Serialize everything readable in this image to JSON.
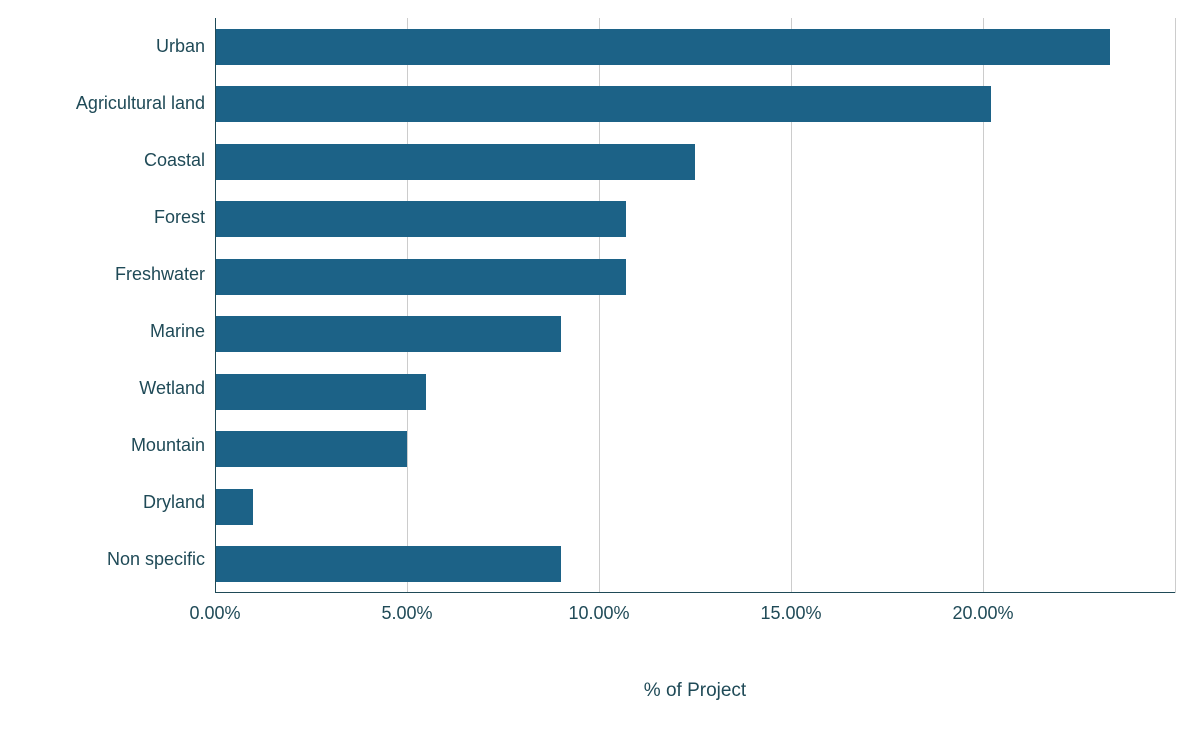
{
  "chart_data": {
    "type": "bar",
    "orientation": "horizontal",
    "categories": [
      "Urban",
      "Agricultural land",
      "Coastal",
      "Forest",
      "Freshwater",
      "Marine",
      "Wetland",
      "Mountain",
      "Dryland",
      "Non specific"
    ],
    "values": [
      23.3,
      20.2,
      12.5,
      10.7,
      10.7,
      9.0,
      5.5,
      5.0,
      1.0,
      9.0
    ],
    "title": "",
    "xlabel": "% of Project",
    "ylabel": "",
    "xlim": [
      0,
      25
    ],
    "xticks": [
      0,
      5,
      10,
      15,
      20
    ],
    "xtick_labels": [
      "0.00%",
      "5.00%",
      "10.00%",
      "15.00%",
      "20.00%"
    ],
    "bar_color": "#1c6287",
    "text_color": "#1f4a57"
  }
}
